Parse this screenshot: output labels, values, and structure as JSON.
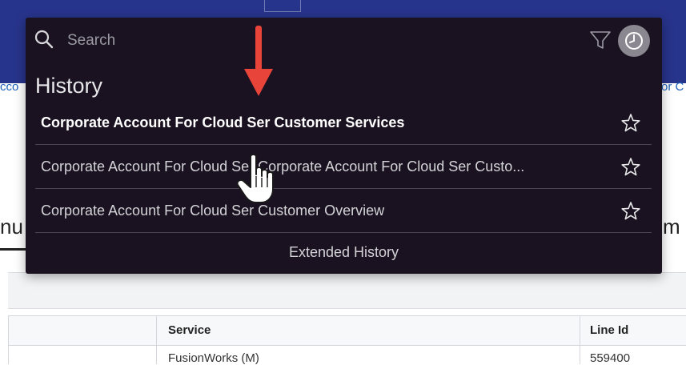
{
  "background": {
    "header_color": "#27348b",
    "left_link_fragment": "cco",
    "right_link_fragment": "or C",
    "left_big_fragment": "nu",
    "right_big_fragment": "m",
    "table": {
      "headers": {
        "service": "Service",
        "line_id": "Line Id"
      },
      "first_row": {
        "service": "FusionWorks (M)",
        "line_id": "559400"
      }
    }
  },
  "popup": {
    "background_color": "#1a1220",
    "search": {
      "placeholder": "Search",
      "value": ""
    },
    "icons": {
      "search": "search-icon",
      "filter": "filter-icon",
      "history": "clock-icon"
    },
    "history_title": "History",
    "items": [
      {
        "label": "Corporate Account For Cloud Ser Customer Services",
        "favorite": false
      },
      {
        "label": "Corporate Account For Cloud Ser Corporate Account For Cloud Ser Custo...",
        "favorite": false
      },
      {
        "label": "Corporate Account For Cloud Ser Customer Overview",
        "favorite": false
      }
    ],
    "extended_history_label": "Extended History"
  },
  "annotations": {
    "arrow_color": "#e8443a"
  }
}
